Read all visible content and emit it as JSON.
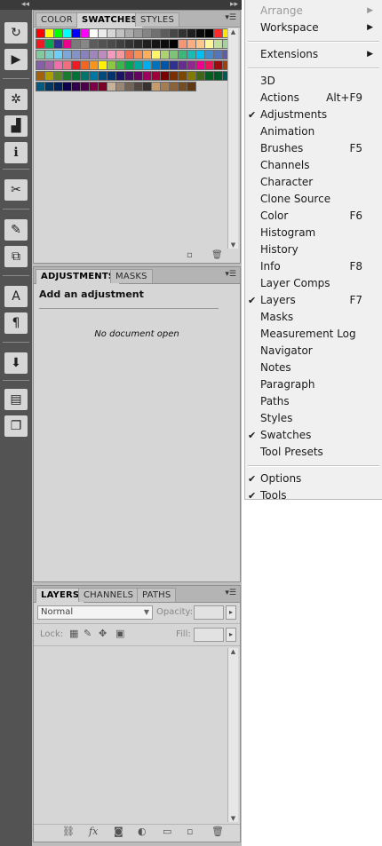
{
  "tool_icons": [
    "history-brush-icon",
    "play-action-icon",
    "navigator-icon",
    "histogram-icon",
    "info-icon",
    "tools-icon",
    "brush-preset-icon",
    "clone-source-icon",
    "character-icon",
    "paragraph-icon",
    "layer-comps-icon",
    "notes-icon",
    "layer-stack-icon"
  ],
  "color_panel": {
    "tabs": [
      "COLOR",
      "SWATCHES",
      "STYLES"
    ],
    "active_tab": "SWATCHES",
    "swatch_rows": [
      [
        "#ff0000",
        "#ffff00",
        "#00ff00",
        "#00ffff",
        "#0000ff",
        "#ff00ff",
        "#ffffff",
        "#ebebeb",
        "#d6d6d6",
        "#c2c2c2",
        "#adadad",
        "#999999",
        "#858585",
        "#707070",
        "#5c5c5c",
        "#474747",
        "#333333",
        "#1f1f1f",
        "#0a0a0a",
        "#000000",
        "#ff2a2a",
        "#ffe600"
      ],
      [
        "#ed1c24",
        "#00a651",
        "#2e3192",
        "#ec008c",
        "#7a7a7a",
        "#878787",
        "#5c5c5c",
        "#525252",
        "#4a4a4a",
        "#3f3f3f",
        "#343434",
        "#2a2a2a",
        "#202020",
        "#151515",
        "#0d0d0d",
        "#000000",
        "#f69679",
        "#f9ad81",
        "#fdc68a",
        "#fff799",
        "#c4df9b",
        "#a3d39c"
      ],
      [
        "#82ca9c",
        "#7accc8",
        "#6dcff6",
        "#7da7d9",
        "#8393ca",
        "#8781bd",
        "#a186be",
        "#bd8cbf",
        "#f49ac1",
        "#f6989d",
        "#f26c4f",
        "#f68e56",
        "#fbaf5d",
        "#fff568",
        "#acd373",
        "#7cc576",
        "#3bb878",
        "#1abbb4",
        "#00bff3",
        "#438ccb",
        "#5574b9",
        "#605ca8"
      ],
      [
        "#855fa8",
        "#a763a8",
        "#f06eaa",
        "#f26d7d",
        "#ed1c24",
        "#f26522",
        "#f7941d",
        "#fff200",
        "#8dc63f",
        "#39b54a",
        "#00a651",
        "#00a99d",
        "#00aeef",
        "#0072bc",
        "#0054a6",
        "#2e3192",
        "#662d91",
        "#92278f",
        "#ec008c",
        "#ed145b",
        "#9e0b0f",
        "#a0410d"
      ],
      [
        "#a36209",
        "#aba000",
        "#598527",
        "#197b30",
        "#007236",
        "#00746b",
        "#0076a3",
        "#004a80",
        "#003471",
        "#1b1464",
        "#440e62",
        "#630460",
        "#9e005d",
        "#9e0039",
        "#790000",
        "#7b2e00",
        "#7d4900",
        "#827b00",
        "#406618",
        "#005e20",
        "#005826",
        "#005952"
      ],
      [
        "#005b7f",
        "#003663",
        "#002157",
        "#0d004c",
        "#32004b",
        "#4b0049",
        "#7b0046",
        "#7a0026",
        "#c7b299",
        "#998675",
        "#736357",
        "#534741",
        "#37302d",
        "#c69c6d",
        "#a67c52",
        "#8c6239",
        "#754c24",
        "#603913"
      ]
    ]
  },
  "adjustments_panel": {
    "tabs": [
      "ADJUSTMENTS",
      "MASKS"
    ],
    "active_tab": "ADJUSTMENTS",
    "title": "Add an adjustment",
    "empty_message": "No document open"
  },
  "layers_panel": {
    "tabs": [
      "LAYERS",
      "CHANNELS",
      "PATHS"
    ],
    "active_tab": "LAYERS",
    "blend_mode": "Normal",
    "opacity_label": "Opacity:",
    "lock_label": "Lock:",
    "fill_label": "Fill:",
    "footer_icons": [
      "link-layers-icon",
      "fx-icon",
      "mask-icon",
      "adjustment-layer-icon",
      "group-folder-icon",
      "new-layer-icon",
      "trash-icon"
    ]
  },
  "window_menu": {
    "items": [
      {
        "label": "Arrange",
        "disabled": true,
        "submenu": true
      },
      {
        "label": "Workspace",
        "submenu": true
      },
      {
        "separator": true
      },
      {
        "label": "Extensions",
        "submenu": true
      },
      {
        "separator": true
      },
      {
        "label": "3D"
      },
      {
        "label": "Actions",
        "shortcut": "Alt+F9"
      },
      {
        "label": "Adjustments",
        "checked": true
      },
      {
        "label": "Animation"
      },
      {
        "label": "Brushes",
        "shortcut": "F5"
      },
      {
        "label": "Channels"
      },
      {
        "label": "Character"
      },
      {
        "label": "Clone Source"
      },
      {
        "label": "Color",
        "shortcut": "F6"
      },
      {
        "label": "Histogram"
      },
      {
        "label": "History"
      },
      {
        "label": "Info",
        "shortcut": "F8"
      },
      {
        "label": "Layer Comps"
      },
      {
        "label": "Layers",
        "shortcut": "F7",
        "checked": true
      },
      {
        "label": "Masks"
      },
      {
        "label": "Measurement Log"
      },
      {
        "label": "Navigator"
      },
      {
        "label": "Notes"
      },
      {
        "label": "Paragraph"
      },
      {
        "label": "Paths"
      },
      {
        "label": "Styles"
      },
      {
        "label": "Swatches",
        "checked": true
      },
      {
        "label": "Tool Presets"
      },
      {
        "separator": true
      },
      {
        "label": "Options",
        "checked": true
      },
      {
        "label": "Tools",
        "checked": true
      }
    ]
  }
}
